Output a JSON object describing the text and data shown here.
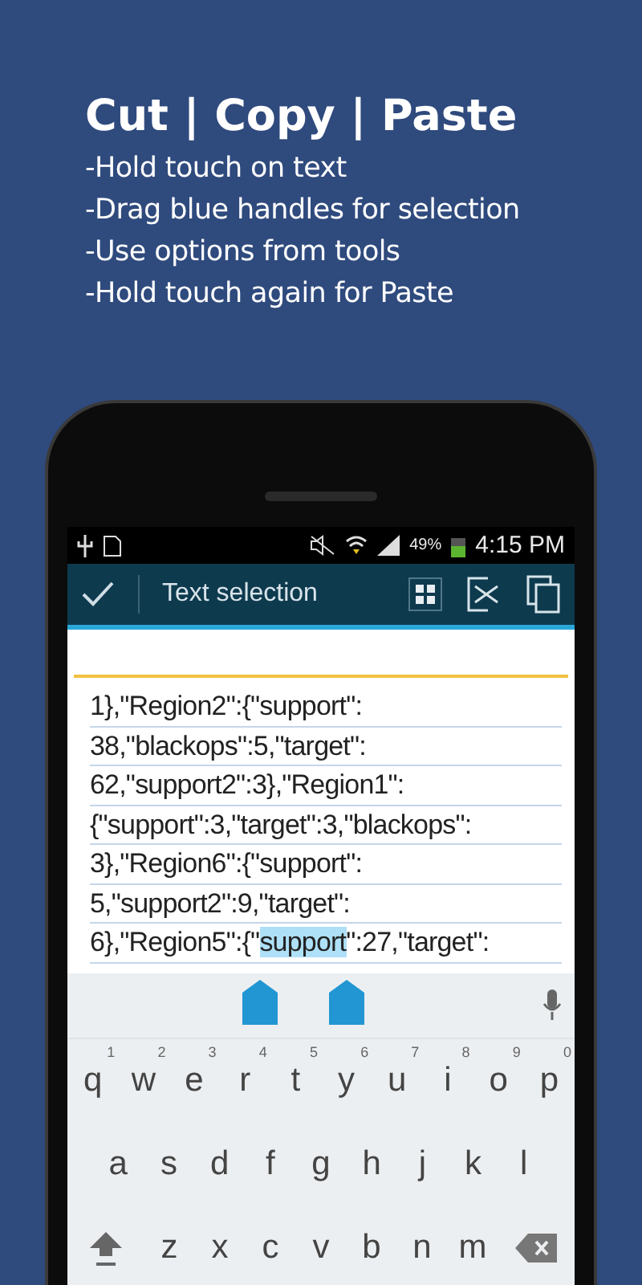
{
  "headline": {
    "title": "Cut | Copy | Paste",
    "steps": [
      "-Hold touch on text",
      "-Drag blue handles for selection",
      "-Use options from tools",
      "-Hold touch again for Paste"
    ]
  },
  "status_bar": {
    "battery": "49%",
    "time": "4:15 PM"
  },
  "action_bar": {
    "title": "Text selection"
  },
  "editor": {
    "lines": [
      {
        "parts": [
          {
            "text": "1},\"Region2\":{\"support\":",
            "selected": false
          }
        ]
      },
      {
        "parts": [
          {
            "text": "38,\"blackops\":5,\"target\":",
            "selected": false
          }
        ]
      },
      {
        "parts": [
          {
            "text": "62,\"support2\":3},\"Region1\":",
            "selected": false
          }
        ]
      },
      {
        "parts": [
          {
            "text": "{\"support\":3,\"target\":3,\"blackops\":",
            "selected": false
          }
        ]
      },
      {
        "parts": [
          {
            "text": "3},\"Region6\":{\"support\":",
            "selected": false
          }
        ]
      },
      {
        "parts": [
          {
            "text": "5,\"support2\":9,\"target\":",
            "selected": false
          }
        ]
      },
      {
        "parts": [
          {
            "text": "6},\"Region5\":{\"",
            "selected": false
          },
          {
            "text": "support",
            "selected": true
          },
          {
            "text": "\":27,\"target\":",
            "selected": false
          }
        ]
      }
    ]
  },
  "keyboard": {
    "rows": [
      [
        {
          "label": "q",
          "hint": "1"
        },
        {
          "label": "w",
          "hint": "2"
        },
        {
          "label": "e",
          "hint": "3"
        },
        {
          "label": "r",
          "hint": "4"
        },
        {
          "label": "t",
          "hint": "5"
        },
        {
          "label": "y",
          "hint": "6"
        },
        {
          "label": "u",
          "hint": "7"
        },
        {
          "label": "i",
          "hint": "8"
        },
        {
          "label": "o",
          "hint": "9"
        },
        {
          "label": "p",
          "hint": "0"
        }
      ],
      [
        {
          "label": "a"
        },
        {
          "label": "s"
        },
        {
          "label": "d"
        },
        {
          "label": "f"
        },
        {
          "label": "g"
        },
        {
          "label": "h"
        },
        {
          "label": "j"
        },
        {
          "label": "k"
        },
        {
          "label": "l"
        }
      ],
      [
        {
          "kind": "shift"
        },
        {
          "label": "z"
        },
        {
          "label": "x"
        },
        {
          "label": "c"
        },
        {
          "label": "v"
        },
        {
          "label": "b"
        },
        {
          "label": "n"
        },
        {
          "label": "m"
        },
        {
          "kind": "backspace"
        }
      ]
    ]
  }
}
